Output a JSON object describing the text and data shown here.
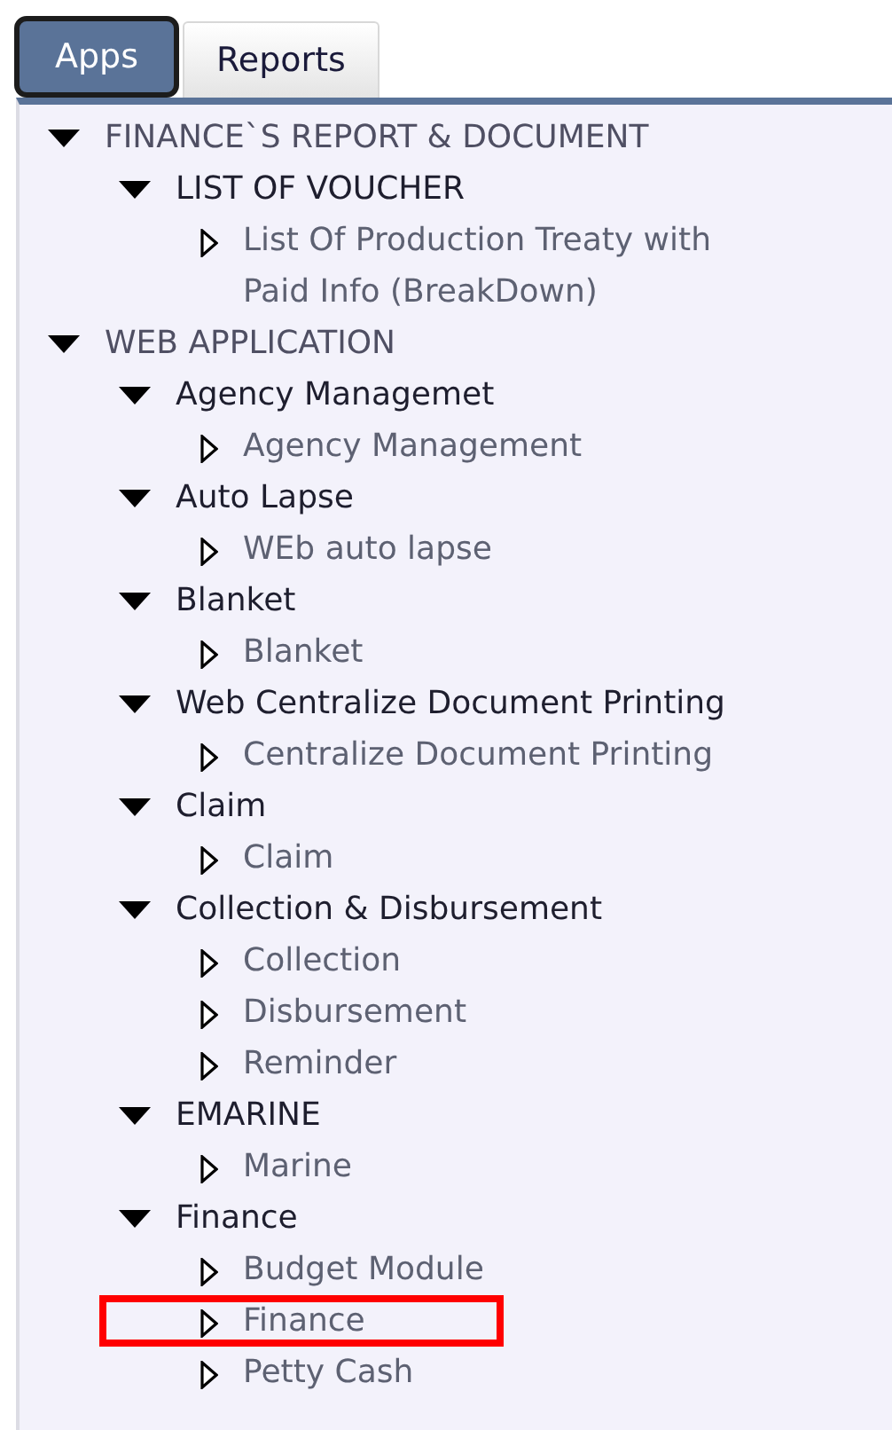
{
  "tabs": [
    {
      "label": "Apps",
      "selected": true
    },
    {
      "label": "Reports",
      "selected": false
    }
  ],
  "tree": [
    {
      "label": "FINANCE`S REPORT & DOCUMENT",
      "expanded": true,
      "children": [
        {
          "label": "LIST OF VOUCHER",
          "expanded": true,
          "children": [
            {
              "label": "List Of Production Treaty with Paid Info (BreakDown)",
              "highlighted": false
            }
          ]
        }
      ]
    },
    {
      "label": "WEB APPLICATION",
      "expanded": true,
      "children": [
        {
          "label": "Agency Managemet",
          "expanded": true,
          "children": [
            {
              "label": "Agency Management",
              "highlighted": false
            }
          ]
        },
        {
          "label": "Auto Lapse",
          "expanded": true,
          "children": [
            {
              "label": "WEb auto lapse",
              "highlighted": false
            }
          ]
        },
        {
          "label": "Blanket",
          "expanded": true,
          "children": [
            {
              "label": "Blanket",
              "highlighted": false
            }
          ]
        },
        {
          "label": "Web Centralize Document Printing",
          "expanded": true,
          "children": [
            {
              "label": "Centralize Document Printing",
              "highlighted": false
            }
          ]
        },
        {
          "label": "Claim",
          "expanded": true,
          "children": [
            {
              "label": "Claim",
              "highlighted": false
            }
          ]
        },
        {
          "label": "Collection & Disbursement",
          "expanded": true,
          "children": [
            {
              "label": "Collection",
              "highlighted": false
            },
            {
              "label": "Disbursement",
              "highlighted": false
            },
            {
              "label": "Reminder",
              "highlighted": false
            }
          ]
        },
        {
          "label": "EMARINE",
          "expanded": true,
          "children": [
            {
              "label": "Marine",
              "highlighted": false
            }
          ]
        },
        {
          "label": "Finance",
          "expanded": true,
          "children": [
            {
              "label": "Budget Module",
              "highlighted": false
            },
            {
              "label": "Finance",
              "highlighted": true
            },
            {
              "label": "Petty Cash",
              "highlighted": false
            }
          ]
        }
      ]
    }
  ]
}
